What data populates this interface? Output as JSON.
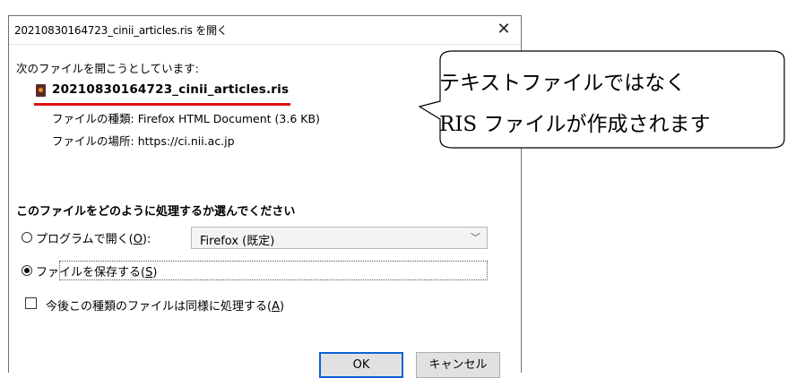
{
  "dialog": {
    "title": "20210830164723_cinii_articles.ris を開く",
    "close_symbol": "✕",
    "intro": "次のファイルを開こうとしています:",
    "filename": "20210830164723_cinii_articles.ris",
    "file_type_label": "ファイルの種類:",
    "file_type_value": "Firefox HTML Document (3.6 KB)",
    "file_location_label": "ファイルの場所:",
    "file_location_value": "https://ci.nii.ac.jp",
    "section_title": "このファイルをどのように処理するか選んでください",
    "open_with_label": "プログラムで開く(",
    "open_with_key": "O",
    "open_with_suffix": "):",
    "open_with_selected": "Firefox (既定)",
    "save_label": "ファイルを保存する(",
    "save_key": "S",
    "save_suffix": ")",
    "remember_label": "今後この種類のファイルは同様に処理する(",
    "remember_key": "A",
    "remember_suffix": ")",
    "selected_option": "save",
    "remember_checked": false,
    "ok_label": "OK",
    "cancel_label": "キャンセル"
  },
  "callout": {
    "line1": "テキストファイルではなく",
    "line2": "RIS ファイルが作成されます"
  },
  "colors": {
    "underline": "#e01010",
    "ok_border": "#0a64d8",
    "file_icon": "#5b2a2a"
  }
}
